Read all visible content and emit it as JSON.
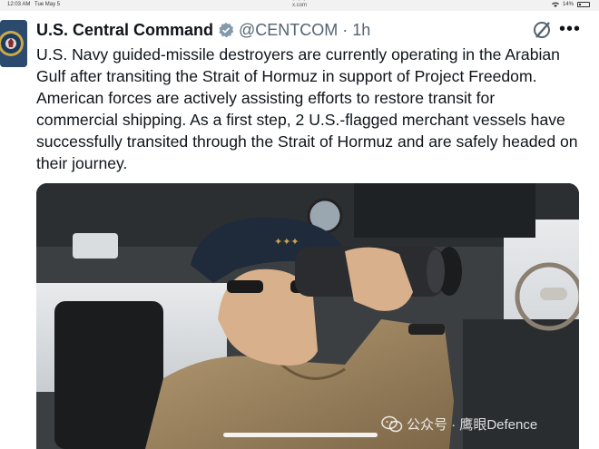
{
  "status_bar": {
    "time": "12:03 AM",
    "date": "Tue May 5",
    "url": "x.com",
    "battery": "14%"
  },
  "tweet": {
    "author_name": "U.S. Central Command",
    "handle": "@CENTCOM",
    "separator": "·",
    "time_ago": "1h",
    "text": "U.S. Navy guided-missile destroyers are currently operating in the Arabian Gulf after transiting the Strait of Hormuz in support of Project Freedom. American forces are actively assisting efforts to restore transit for commercial shipping. As a first step, 2 U.S.-flagged merchant vessels have successfully transited through the Strait of Hormuz and are safely headed on their journey.",
    "more_glyph": "•••"
  },
  "watermark": {
    "text": "公众号 · 鹰眼Defence"
  },
  "colors": {
    "text": "#0f1419",
    "secondary": "#536471",
    "verified": "#829aab",
    "background": "#ffffff"
  },
  "icons": [
    "verified-badge-icon",
    "grok-icon",
    "more-options-icon",
    "wechat-icon",
    "wifi-icon",
    "battery-icon"
  ]
}
